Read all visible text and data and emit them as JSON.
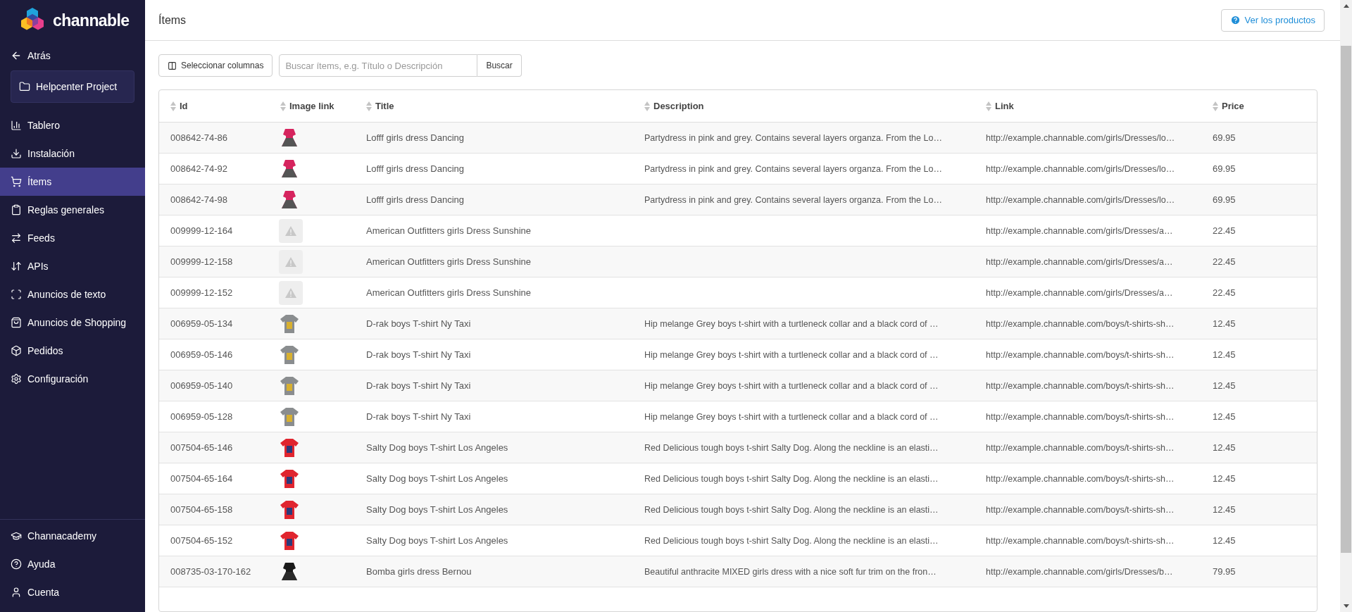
{
  "brand": "channable",
  "back": "Atrás",
  "project": "Helpcenter Project",
  "nav": [
    {
      "label": "Tablero",
      "selected": false
    },
    {
      "label": "Instalación",
      "selected": false
    },
    {
      "label": "Ítems",
      "selected": true
    },
    {
      "label": "Reglas generales",
      "selected": false
    },
    {
      "label": "Feeds",
      "selected": false
    },
    {
      "label": "APIs",
      "selected": false
    },
    {
      "label": "Anuncios de texto",
      "selected": false
    },
    {
      "label": "Anuncios de Shopping",
      "selected": false
    },
    {
      "label": "Pedidos",
      "selected": false
    },
    {
      "label": "Configuración",
      "selected": false
    }
  ],
  "bottom_nav": [
    "Channacademy",
    "Ayuda",
    "Cuenta"
  ],
  "page_title": "Ítems",
  "help_button": "Ver los productos",
  "columns_button": "Seleccionar columnas",
  "search": {
    "placeholder": "Buscar ítems, e.g. Título o Descripción",
    "button": "Buscar"
  },
  "table": {
    "columns": [
      "Id",
      "Image link",
      "Title",
      "Description",
      "Link",
      "Price"
    ],
    "rows": [
      {
        "id": "008642-74-86",
        "kind": "pink-dress",
        "title": "Lofff girls dress Dancing",
        "description": "Partydress in pink and grey. Contains several layers organza. From the Lo…",
        "link": "http://example.channable.com/girls/Dresses/lo…",
        "price": "69.95"
      },
      {
        "id": "008642-74-92",
        "kind": "pink-dress",
        "title": "Lofff girls dress Dancing",
        "description": "Partydress in pink and grey. Contains several layers organza. From the Lo…",
        "link": "http://example.channable.com/girls/Dresses/lo…",
        "price": "69.95"
      },
      {
        "id": "008642-74-98",
        "kind": "pink-dress",
        "title": "Lofff girls dress Dancing",
        "description": "Partydress in pink and grey. Contains several layers organza. From the Lo…",
        "link": "http://example.channable.com/girls/Dresses/lo…",
        "price": "69.95"
      },
      {
        "id": "009999-12-164",
        "kind": "missing",
        "title": "American Outfitters girls Dress Sunshine",
        "link": "http://example.channable.com/girls/Dresses/a…",
        "price": "22.45"
      },
      {
        "id": "009999-12-158",
        "kind": "missing",
        "title": "American Outfitters girls Dress Sunshine",
        "link": "http://example.channable.com/girls/Dresses/a…",
        "price": "22.45"
      },
      {
        "id": "009999-12-152",
        "kind": "missing",
        "title": "American Outfitters girls Dress Sunshine",
        "link": "http://example.channable.com/girls/Dresses/a…",
        "price": "22.45"
      },
      {
        "id": "006959-05-134",
        "kind": "grey-tshirt",
        "title": "D-rak boys T-shirt Ny Taxi",
        "description": "Hip melange Grey boys t-shirt with a turtleneck collar and a black cord of …",
        "link": "http://example.channable.com/boys/t-shirts-sh…",
        "price": "12.45"
      },
      {
        "id": "006959-05-146",
        "kind": "grey-tshirt",
        "title": "D-rak boys T-shirt Ny Taxi",
        "description": "Hip melange Grey boys t-shirt with a turtleneck collar and a black cord of …",
        "link": "http://example.channable.com/boys/t-shirts-sh…",
        "price": "12.45"
      },
      {
        "id": "006959-05-140",
        "kind": "grey-tshirt",
        "title": "D-rak boys T-shirt Ny Taxi",
        "description": "Hip melange Grey boys t-shirt with a turtleneck collar and a black cord of …",
        "link": "http://example.channable.com/boys/t-shirts-sh…",
        "price": "12.45"
      },
      {
        "id": "006959-05-128",
        "kind": "grey-tshirt",
        "title": "D-rak boys T-shirt Ny Taxi",
        "description": "Hip melange Grey boys t-shirt with a turtleneck collar and a black cord of …",
        "link": "http://example.channable.com/boys/t-shirts-sh…",
        "price": "12.45"
      },
      {
        "id": "007504-65-146",
        "kind": "red-tshirt",
        "title": "Salty Dog boys T-shirt Los Angeles",
        "description": "Red Delicious tough boys t-shirt Salty Dog. Along the neckline is an elasti…",
        "link": "http://example.channable.com/boys/t-shirts-sh…",
        "price": "12.45"
      },
      {
        "id": "007504-65-164",
        "kind": "red-tshirt",
        "title": "Salty Dog boys T-shirt Los Angeles",
        "description": "Red Delicious tough boys t-shirt Salty Dog. Along the neckline is an elasti…",
        "link": "http://example.channable.com/boys/t-shirts-sh…",
        "price": "12.45"
      },
      {
        "id": "007504-65-158",
        "kind": "red-tshirt",
        "title": "Salty Dog boys T-shirt Los Angeles",
        "description": "Red Delicious tough boys t-shirt Salty Dog. Along the neckline is an elasti…",
        "link": "http://example.channable.com/boys/t-shirts-sh…",
        "price": "12.45"
      },
      {
        "id": "007504-65-152",
        "kind": "red-tshirt",
        "title": "Salty Dog boys T-shirt Los Angeles",
        "description": "Red Delicious tough boys t-shirt Salty Dog. Along the neckline is an elasti…",
        "link": "http://example.channable.com/boys/t-shirts-sh…",
        "price": "12.45"
      },
      {
        "id": "008735-03-170-162",
        "kind": "black-dress",
        "title": "Bomba girls dress Bernou",
        "description": "Beautiful anthracite MIXED girls dress with a nice soft fur trim on the fron…",
        "link": "http://example.channable.com/girls/Dresses/b…",
        "price": "79.95"
      }
    ]
  }
}
